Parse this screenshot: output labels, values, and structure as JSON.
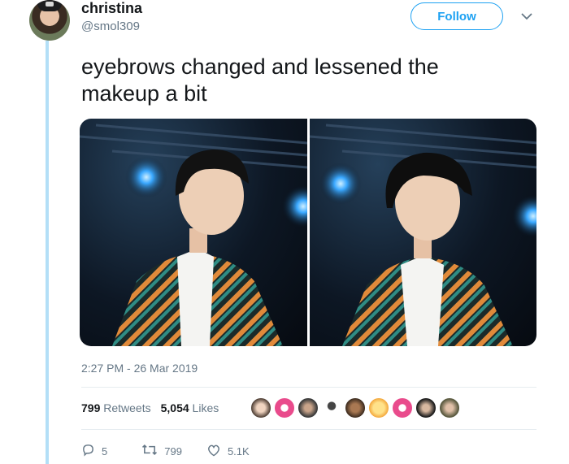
{
  "author": {
    "display_name": "christina",
    "handle": "@smol309"
  },
  "follow_label": "Follow",
  "tweet": {
    "text_line1": "eyebrows changed and lessened the",
    "text_line2": "makeup a bit",
    "timestamp": "2:27 PM - 26 Mar 2019"
  },
  "stats": {
    "retweets_count": "799",
    "retweets_label": "Retweets",
    "likes_count": "5,054",
    "likes_label": "Likes"
  },
  "actions": {
    "replies": "5",
    "retweets": "799",
    "likes": "5.1K"
  },
  "colors": {
    "accent": "#1da1f2",
    "thread_line": "#b3dff7",
    "secondary_text": "#657786"
  },
  "icons": [
    "chevron-down-icon",
    "reply-icon",
    "retweet-icon",
    "like-icon"
  ]
}
